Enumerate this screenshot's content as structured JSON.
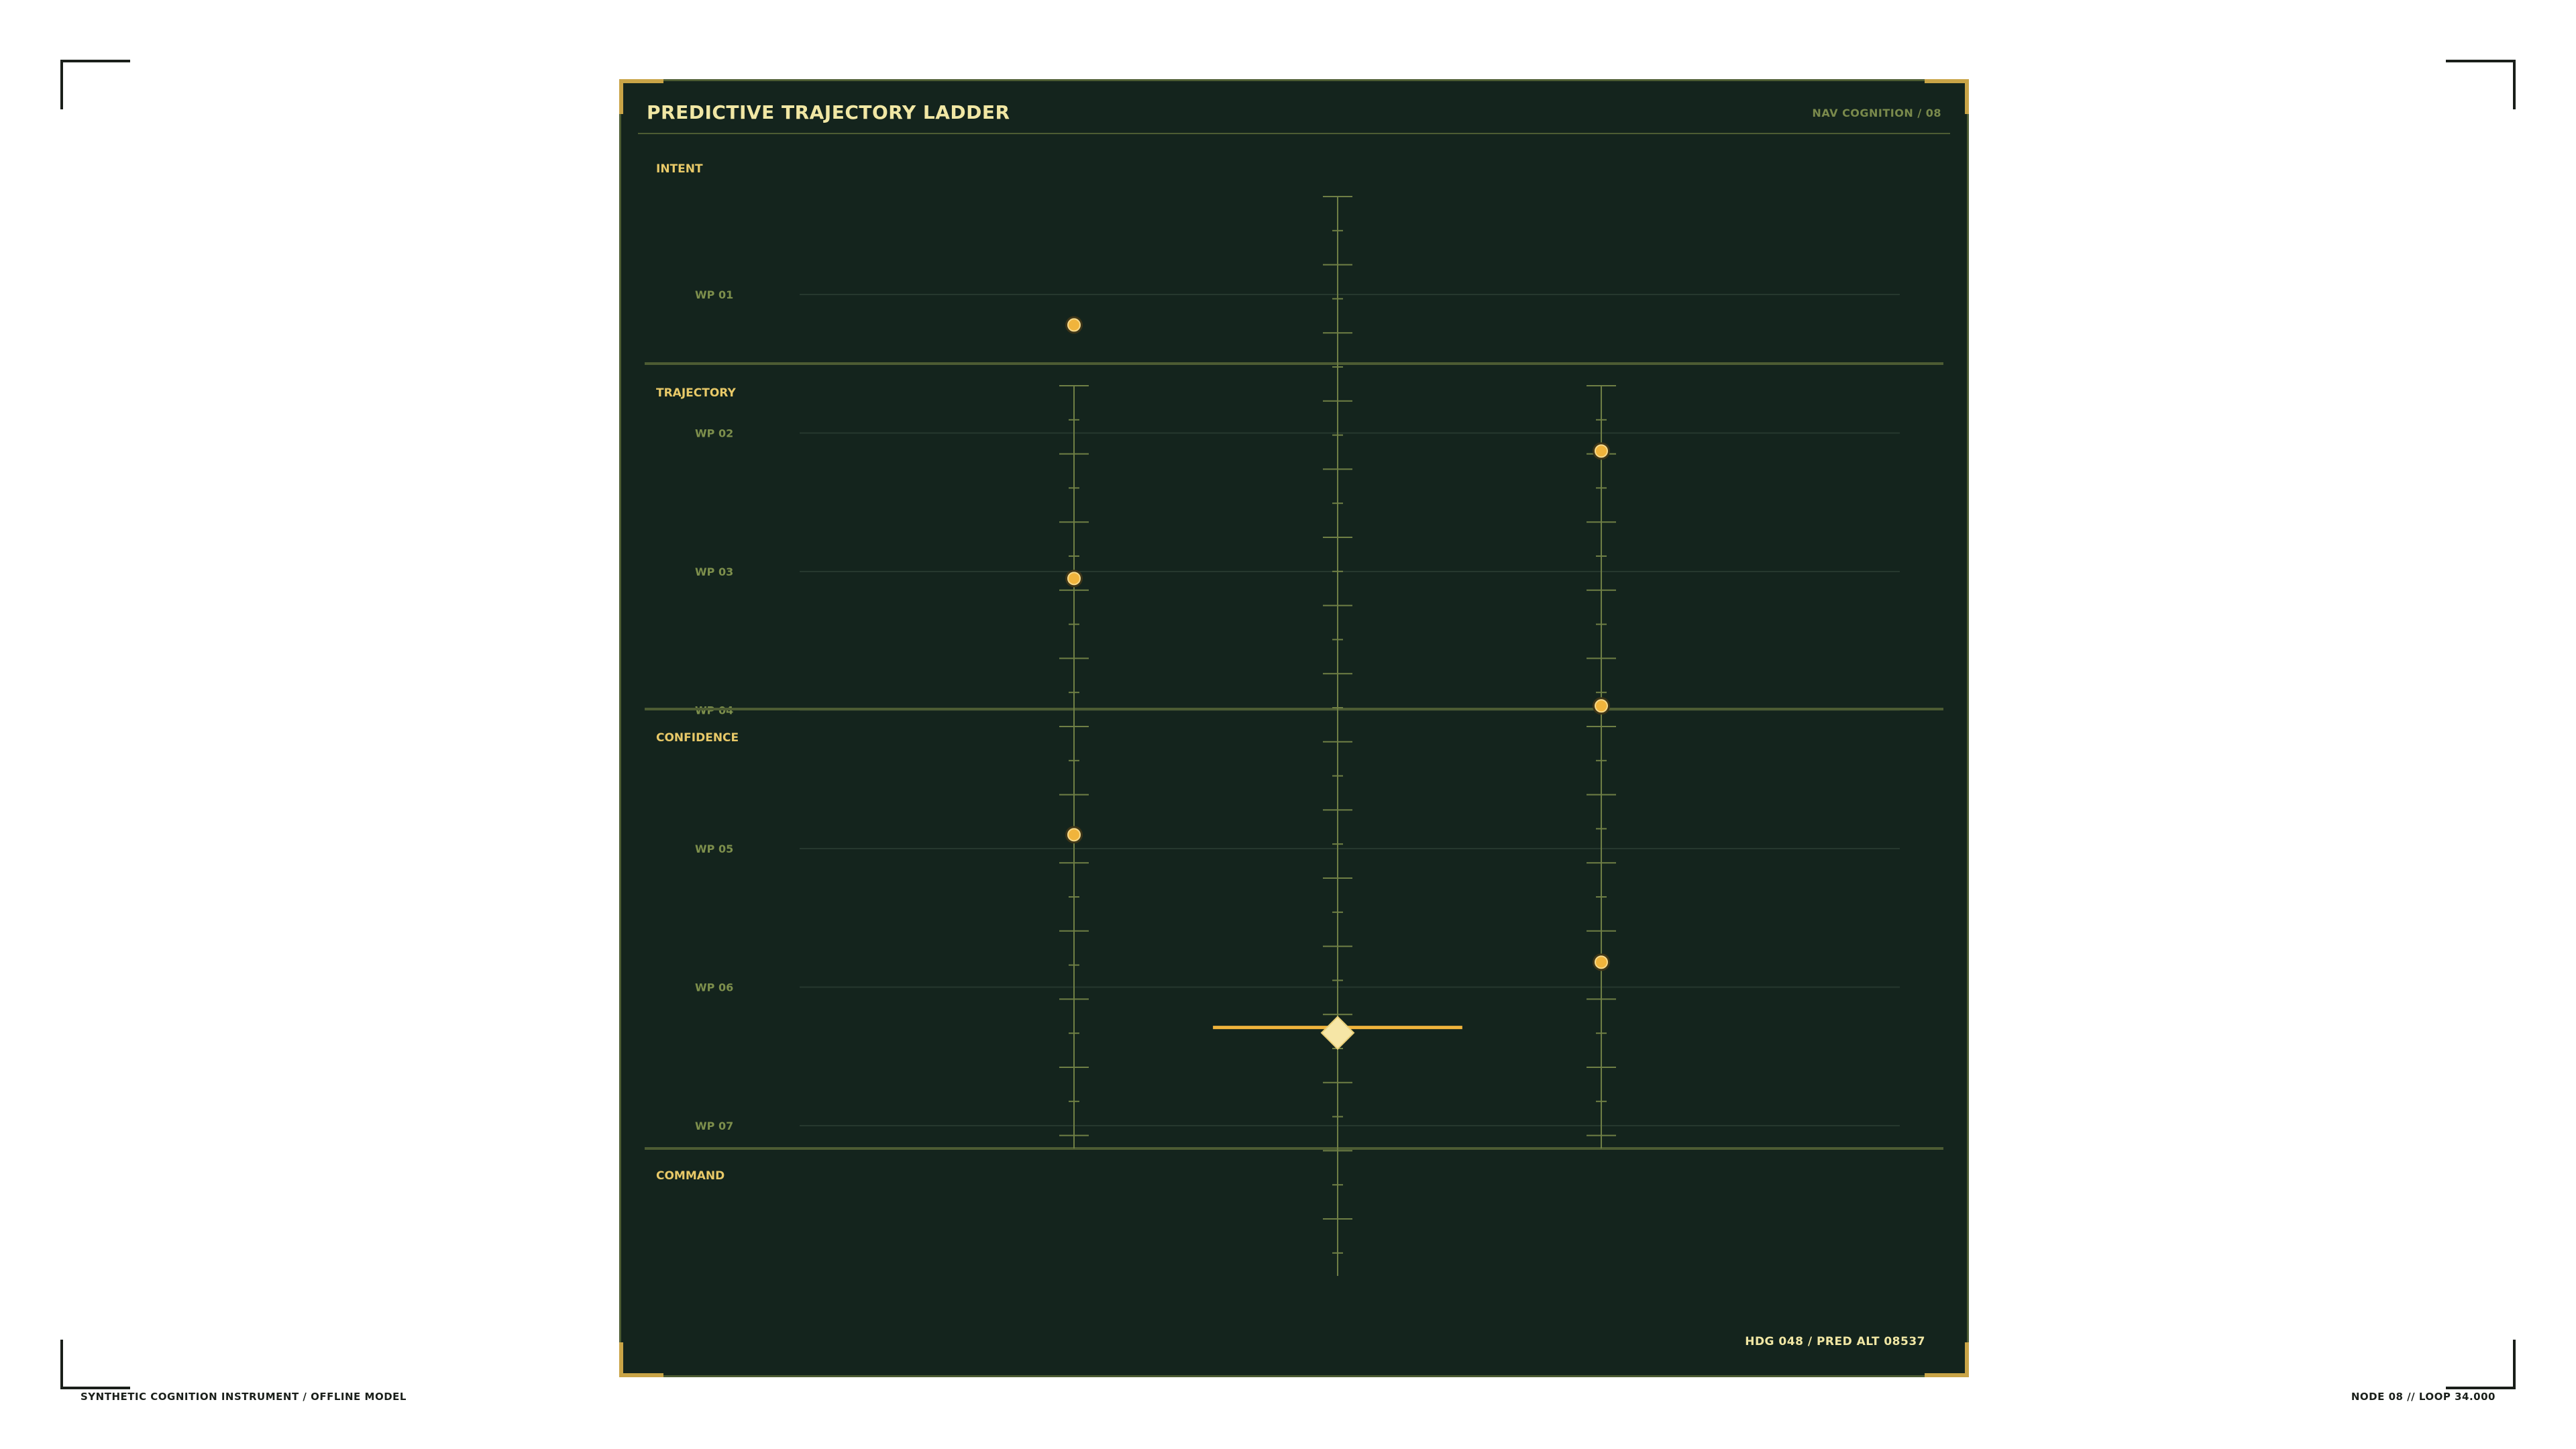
{
  "screen": {
    "footer_left": "SYNTHETIC COGNITION INSTRUMENT / OFFLINE MODEL",
    "footer_right": "NODE 08 // LOOP 34.000"
  },
  "panel": {
    "title": "PREDICTIVE TRAJECTORY LADDER",
    "subtitle": "NAV COGNITION / 08",
    "readout": "HDG 048 / PRED ALT 08537"
  },
  "sections": [
    {
      "label": "INTENT"
    },
    {
      "label": "TRAJECTORY"
    },
    {
      "label": "CONFIDENCE"
    },
    {
      "label": "COMMAND"
    }
  ],
  "waypoints": [
    {
      "label": "WP 01"
    },
    {
      "label": "WP 02"
    },
    {
      "label": "WP 03"
    },
    {
      "label": "WP 04"
    },
    {
      "label": "WP 05"
    },
    {
      "label": "WP 06"
    },
    {
      "label": "WP 07"
    }
  ],
  "colors": {
    "panel_bg": "#14241d",
    "frame": "#4d5c33",
    "rail": "#6f7f45",
    "gridline": "#26382e",
    "accent_gold": "#c9a447",
    "marker": "#f0b43c",
    "predicted": "#f6e6a6",
    "text_label": "#e8c968",
    "text_wp": "#7d8f4c"
  },
  "rails": [
    {
      "name": "left-rail",
      "markers_at_wp": [
        1.22,
        3.05,
        4.9
      ]
    },
    {
      "name": "center-rail",
      "predicted_at_wp": 6.33,
      "predicted_span": 0.9
    },
    {
      "name": "right-rail",
      "markers_at_wp": [
        2.13,
        3.97,
        5.82
      ]
    }
  ]
}
